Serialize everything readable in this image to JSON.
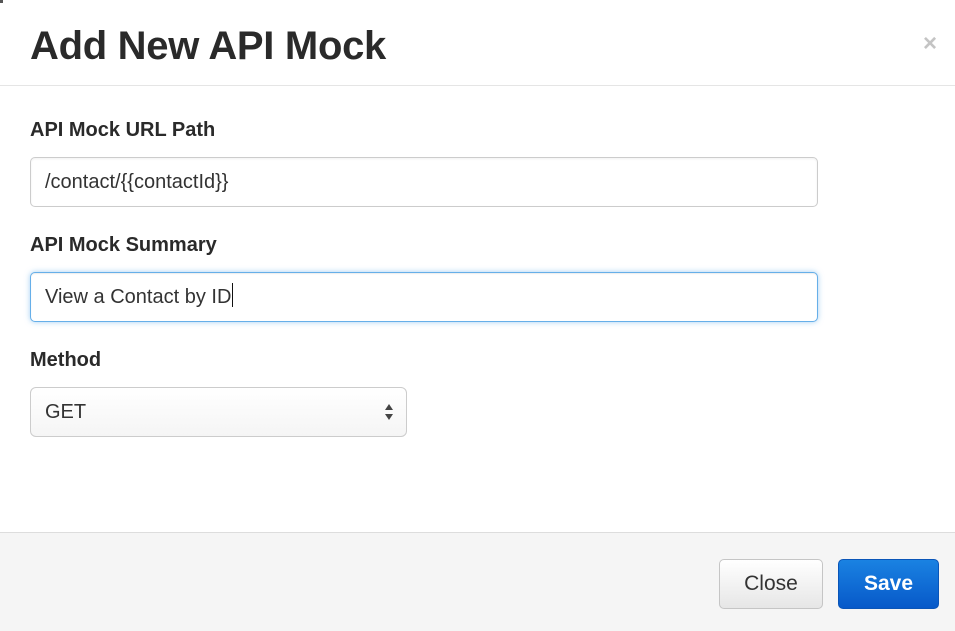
{
  "modal": {
    "title": "Add New API Mock",
    "close_glyph": "×"
  },
  "form": {
    "url_path": {
      "label": "API Mock URL Path",
      "value": "/contact/{{contactId}}"
    },
    "summary": {
      "label": "API Mock Summary",
      "value": "View a Contact by ID"
    },
    "method": {
      "label": "Method",
      "selected": "GET"
    }
  },
  "footer": {
    "close_label": "Close",
    "save_label": "Save"
  },
  "colors": {
    "primary": "#0f6fd8",
    "focus_ring": "#66afe9",
    "footer_bg": "#f5f5f5"
  }
}
